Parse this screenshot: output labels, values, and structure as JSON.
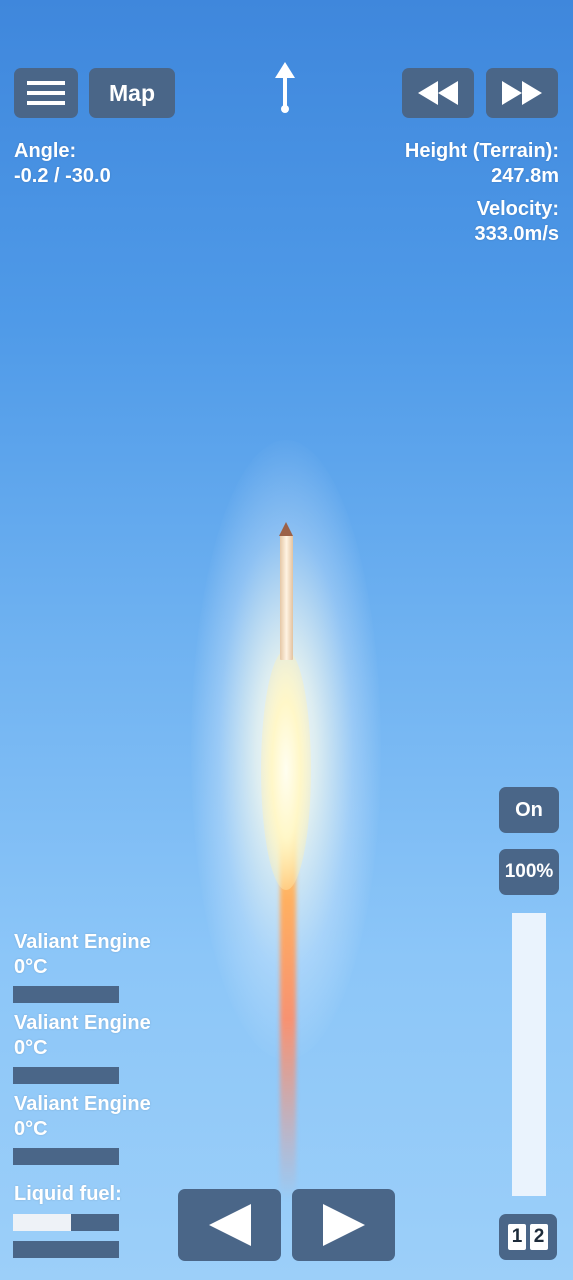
{
  "top_bar": {
    "menu_icon": "hamburger-menu-icon",
    "map_label": "Map",
    "direction_icon": "up-arrow-icon",
    "rewind_icon": "rewind-icon",
    "fast_forward_icon": "fast-forward-icon"
  },
  "telemetry": {
    "angle_label": "Angle:",
    "angle_value": "-0.2 / -30.0",
    "height_label": "Height (Terrain):",
    "height_value": "247.8m",
    "velocity_label": "Velocity:",
    "velocity_value": "333.0m/s"
  },
  "engines": [
    {
      "name": "Valiant Engine",
      "temp": "0°C",
      "heat_fraction": 0.0
    },
    {
      "name": "Valiant Engine",
      "temp": "0°C",
      "heat_fraction": 0.0
    },
    {
      "name": "Valiant Engine",
      "temp": "0°C",
      "heat_fraction": 0.0
    }
  ],
  "fuel": {
    "label": "Liquid fuel:",
    "stage_fraction": 0.55,
    "total_fraction": 0.0
  },
  "controls": {
    "engine_toggle_label": "On",
    "throttle_label": "100%",
    "throttle_fraction": 1.0,
    "rotate_left_icon": "left-arrow-icon",
    "rotate_right_icon": "right-arrow-icon",
    "stage_digits": [
      "1",
      "2"
    ]
  },
  "colors": {
    "button_bg": "#4a6688",
    "sky_top": "#3f87dc",
    "sky_bottom": "#9ccff9"
  }
}
